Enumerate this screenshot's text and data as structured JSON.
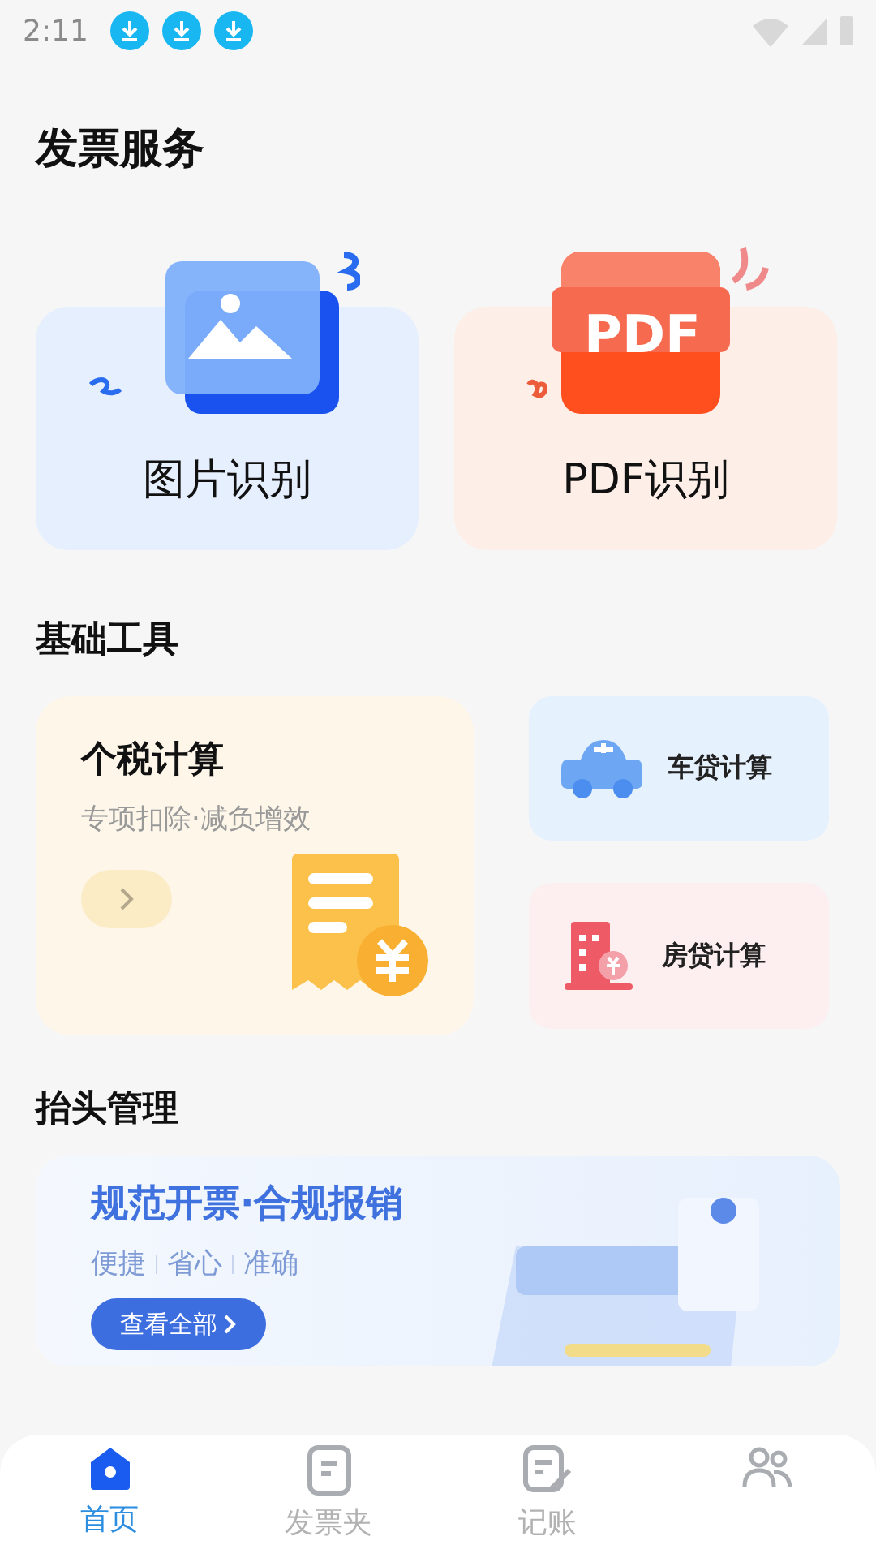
{
  "status_bar": {
    "time": "2:11",
    "notifications": [
      {
        "kind": "download"
      },
      {
        "kind": "download"
      },
      {
        "kind": "download"
      }
    ]
  },
  "invoice_services": {
    "title": "发票服务",
    "cards": [
      {
        "kind": "image",
        "label": "图片识别"
      },
      {
        "kind": "pdf",
        "label": "PDF识别",
        "badge": "PDF"
      }
    ]
  },
  "basic_tools": {
    "title": "基础工具",
    "tax": {
      "title": "个税计算",
      "subtitle": "专项扣除·减负增效"
    },
    "tools": [
      {
        "kind": "car",
        "label": "车贷计算"
      },
      {
        "kind": "house",
        "label": "房贷计算"
      }
    ]
  },
  "header_management": {
    "title": "抬头管理",
    "banner": {
      "title": "规范开票·合规报销",
      "tags": [
        "便捷",
        "省心",
        "准确"
      ],
      "button": "查看全部"
    }
  },
  "tab_bar": [
    {
      "kind": "home",
      "label": "首页",
      "selected": true
    },
    {
      "kind": "folder",
      "label": "发票夹",
      "selected": false
    },
    {
      "kind": "note",
      "label": "记账",
      "selected": false
    },
    {
      "kind": "people",
      "selected": false
    }
  ]
}
